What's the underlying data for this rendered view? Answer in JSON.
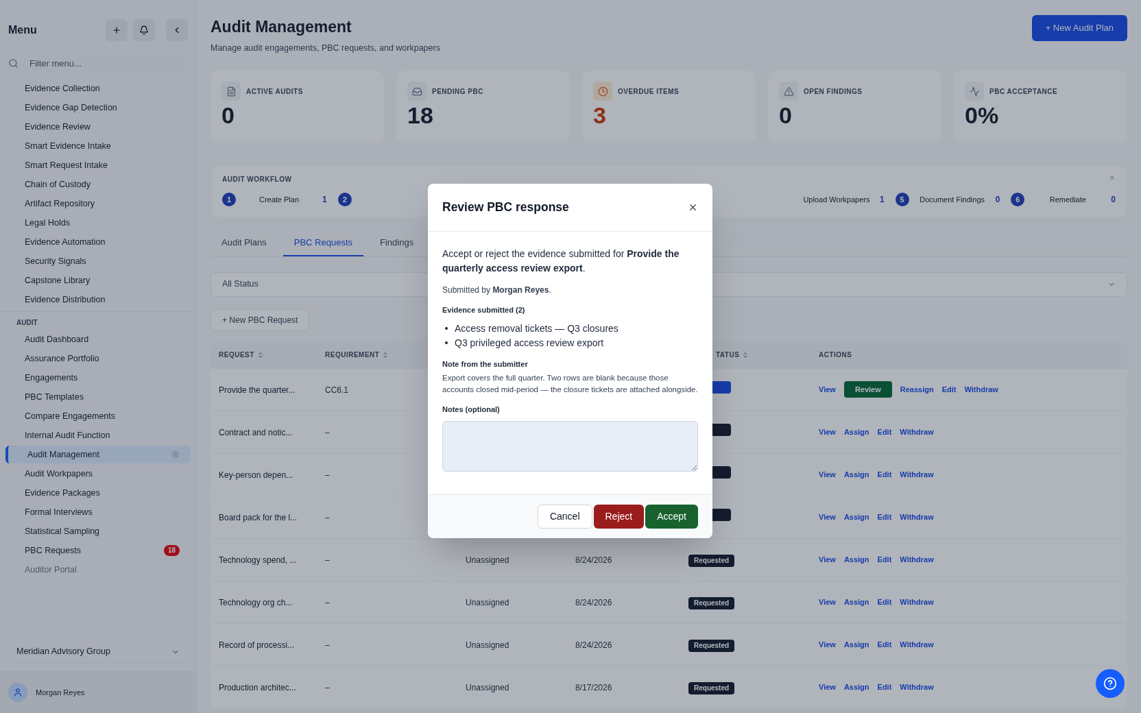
{
  "sidebar": {
    "title": "Menu",
    "filter": {
      "placeholder": "Filter menu..."
    },
    "groups": [
      {
        "items": [
          {
            "label": "Evidence Collection",
            "selected": false,
            "faded": false
          },
          {
            "label": "Evidence Gap Detection",
            "selected": false,
            "faded": false
          },
          {
            "label": "Evidence Review",
            "selected": false,
            "faded": false
          },
          {
            "label": "Smart Evidence Intake",
            "selected": false,
            "faded": false
          },
          {
            "label": "Smart Request Intake",
            "selected": false,
            "faded": false
          },
          {
            "label": "Chain of Custody",
            "selected": false,
            "faded": false
          },
          {
            "label": "Artifact Repository",
            "selected": false,
            "faded": false
          },
          {
            "label": "Legal Holds",
            "selected": false,
            "faded": false
          },
          {
            "label": "Evidence Automation",
            "selected": false,
            "faded": false
          },
          {
            "label": "Security Signals",
            "selected": false,
            "faded": false
          },
          {
            "label": "Capstone Library",
            "selected": false,
            "faded": false
          },
          {
            "label": "Evidence Distribution",
            "selected": false,
            "faded": false
          }
        ]
      },
      {
        "heading": "AUDIT",
        "items": [
          {
            "label": "Audit Dashboard",
            "selected": false,
            "faded": false
          },
          {
            "label": "Assurance Portfolio",
            "selected": false,
            "faded": false
          },
          {
            "label": "Engagements",
            "selected": false,
            "faded": false
          },
          {
            "label": "PBC Templates",
            "selected": false,
            "faded": false
          },
          {
            "label": "Compare Engagements",
            "selected": false,
            "faded": false
          },
          {
            "label": "Internal Audit Function",
            "selected": false,
            "faded": false
          },
          {
            "label": "Audit Management",
            "selected": true,
            "faded": false
          },
          {
            "label": "Audit Workpapers",
            "selected": false,
            "faded": false
          },
          {
            "label": "Evidence Packages",
            "selected": false,
            "faded": false
          },
          {
            "label": "Formal Interviews",
            "selected": false,
            "faded": false
          },
          {
            "label": "Statistical Sampling",
            "selected": false,
            "faded": false
          },
          {
            "label": "PBC Requests",
            "selected": false,
            "faded": false,
            "badge": "18"
          },
          {
            "label": "Auditor Portal",
            "selected": false,
            "faded": true
          }
        ]
      }
    ],
    "organization": "Meridian Advisory Group",
    "user": "Morgan Reyes"
  },
  "page": {
    "title": "Audit Management",
    "subtitle": "Manage audit engagements, PBC requests, and workpapers",
    "new_button": "+ New Audit Plan"
  },
  "stats": [
    {
      "label": "ACTIVE AUDITS",
      "value": "0",
      "kind": "file"
    },
    {
      "label": "PENDING PBC",
      "value": "18",
      "kind": "inbox"
    },
    {
      "label": "OVERDUE ITEMS",
      "value": "3",
      "kind": "clock"
    },
    {
      "label": "OPEN FINDINGS",
      "value": "0",
      "kind": "alert"
    },
    {
      "label": "PBC ACCEPTANCE",
      "value": "0%",
      "kind": "activity"
    }
  ],
  "workflow": {
    "title": "AUDIT WORKFLOW",
    "left": [
      {
        "number": "1",
        "label": "Create Plan",
        "count": "1"
      },
      {
        "number": "2"
      }
    ],
    "right": [
      {
        "label": "Upload Workpapers",
        "count": "1"
      },
      {
        "number": "5",
        "label": "Document Findings",
        "count": "0"
      },
      {
        "number": "6",
        "label": "Remediate",
        "count": "0"
      }
    ]
  },
  "tabs": [
    {
      "label": "Audit Plans",
      "selected": false
    },
    {
      "label": "PBC Requests",
      "selected": true
    },
    {
      "label": "Findings",
      "selected": false
    }
  ],
  "status_filter": "All Status",
  "new_request_button": "+ New PBC Request",
  "table": {
    "columns": [
      "REQUEST",
      "REQUIREMENT",
      "TATUS",
      "ACTIONS"
    ],
    "rows": [
      {
        "request": "Provide the quarter...",
        "requirement": "CC6.1",
        "status_badge": {
          "kind": "submitted"
        },
        "actions": [
          {
            "label": "View",
            "kind": "link"
          },
          {
            "label": "Review",
            "kind": "button"
          },
          {
            "label": "Reassign",
            "kind": "link"
          },
          {
            "label": "Edit",
            "kind": "link"
          },
          {
            "label": "Withdraw",
            "kind": "link"
          }
        ]
      },
      {
        "request": "Contract and notic...",
        "requirement": "–",
        "status_badge": {
          "kind": "requested"
        },
        "actions": [
          {
            "label": "View",
            "kind": "link"
          },
          {
            "label": "Assign",
            "kind": "link"
          },
          {
            "label": "Edit",
            "kind": "link"
          },
          {
            "label": "Withdraw",
            "kind": "link"
          }
        ]
      },
      {
        "request": "Key-person depen...",
        "requirement": "–",
        "status_badge": {
          "kind": "requested"
        },
        "actions": [
          {
            "label": "View",
            "kind": "link"
          },
          {
            "label": "Assign",
            "kind": "link"
          },
          {
            "label": "Edit",
            "kind": "link"
          },
          {
            "label": "Withdraw",
            "kind": "link"
          }
        ]
      },
      {
        "request": "Board pack for the l...",
        "requirement": "–",
        "status_badge": {
          "kind": "requested"
        },
        "actions": [
          {
            "label": "View",
            "kind": "link"
          },
          {
            "label": "Assign",
            "kind": "link"
          },
          {
            "label": "Edit",
            "kind": "link"
          },
          {
            "label": "Withdraw",
            "kind": "link"
          }
        ]
      },
      {
        "request": "Technology spend, ...",
        "requirement": "–",
        "assignee": "Unassigned",
        "due": "8/24/2026",
        "status_badge": {
          "label": "Requested",
          "kind": "requested"
        },
        "actions": [
          {
            "label": "View",
            "kind": "link"
          },
          {
            "label": "Assign",
            "kind": "link"
          },
          {
            "label": "Edit",
            "kind": "link"
          },
          {
            "label": "Withdraw",
            "kind": "link"
          }
        ]
      },
      {
        "request": "Technology org ch...",
        "requirement": "–",
        "assignee": "Unassigned",
        "due": "8/24/2026",
        "status_badge": {
          "label": "Requested",
          "kind": "requested"
        },
        "actions": [
          {
            "label": "View",
            "kind": "link"
          },
          {
            "label": "Assign",
            "kind": "link"
          },
          {
            "label": "Edit",
            "kind": "link"
          },
          {
            "label": "Withdraw",
            "kind": "link"
          }
        ]
      },
      {
        "request": "Record of processi...",
        "requirement": "–",
        "assignee": "Unassigned",
        "due": "8/24/2026",
        "status_badge": {
          "label": "Requested",
          "kind": "requested"
        },
        "actions": [
          {
            "label": "View",
            "kind": "link"
          },
          {
            "label": "Assign",
            "kind": "link"
          },
          {
            "label": "Edit",
            "kind": "link"
          },
          {
            "label": "Withdraw",
            "kind": "link"
          }
        ]
      },
      {
        "request": "Production architec...",
        "requirement": "–",
        "assignee": "Unassigned",
        "due": "8/17/2026",
        "status_badge": {
          "label": "Requested",
          "kind": "requested"
        },
        "actions": [
          {
            "label": "View",
            "kind": "link"
          },
          {
            "label": "Assign",
            "kind": "link"
          },
          {
            "label": "Edit",
            "kind": "link"
          },
          {
            "label": "Withdraw",
            "kind": "link"
          }
        ]
      }
    ]
  },
  "dialog": {
    "title": "Review PBC response",
    "intro": "Accept or reject the evidence submitted for **Provide the quarterly access review export**.",
    "submitted_by": "Submitted by **Morgan Reyes**.",
    "evidence_heading": "Evidence submitted (2)",
    "evidence": [
      "Access removal tickets — Q3 closures",
      "Q3 privileged access review export"
    ],
    "note_heading": "Note from the submitter",
    "note": "Export covers the full quarter. Two rows are blank because those accounts closed mid-period — the closure tickets are attached alongside.",
    "notes_label": "Notes (optional)",
    "buttons": [
      {
        "label": "Cancel",
        "kind": "cancel"
      },
      {
        "label": "Reject",
        "kind": "reject"
      },
      {
        "label": "Accept",
        "kind": "accept"
      }
    ]
  }
}
